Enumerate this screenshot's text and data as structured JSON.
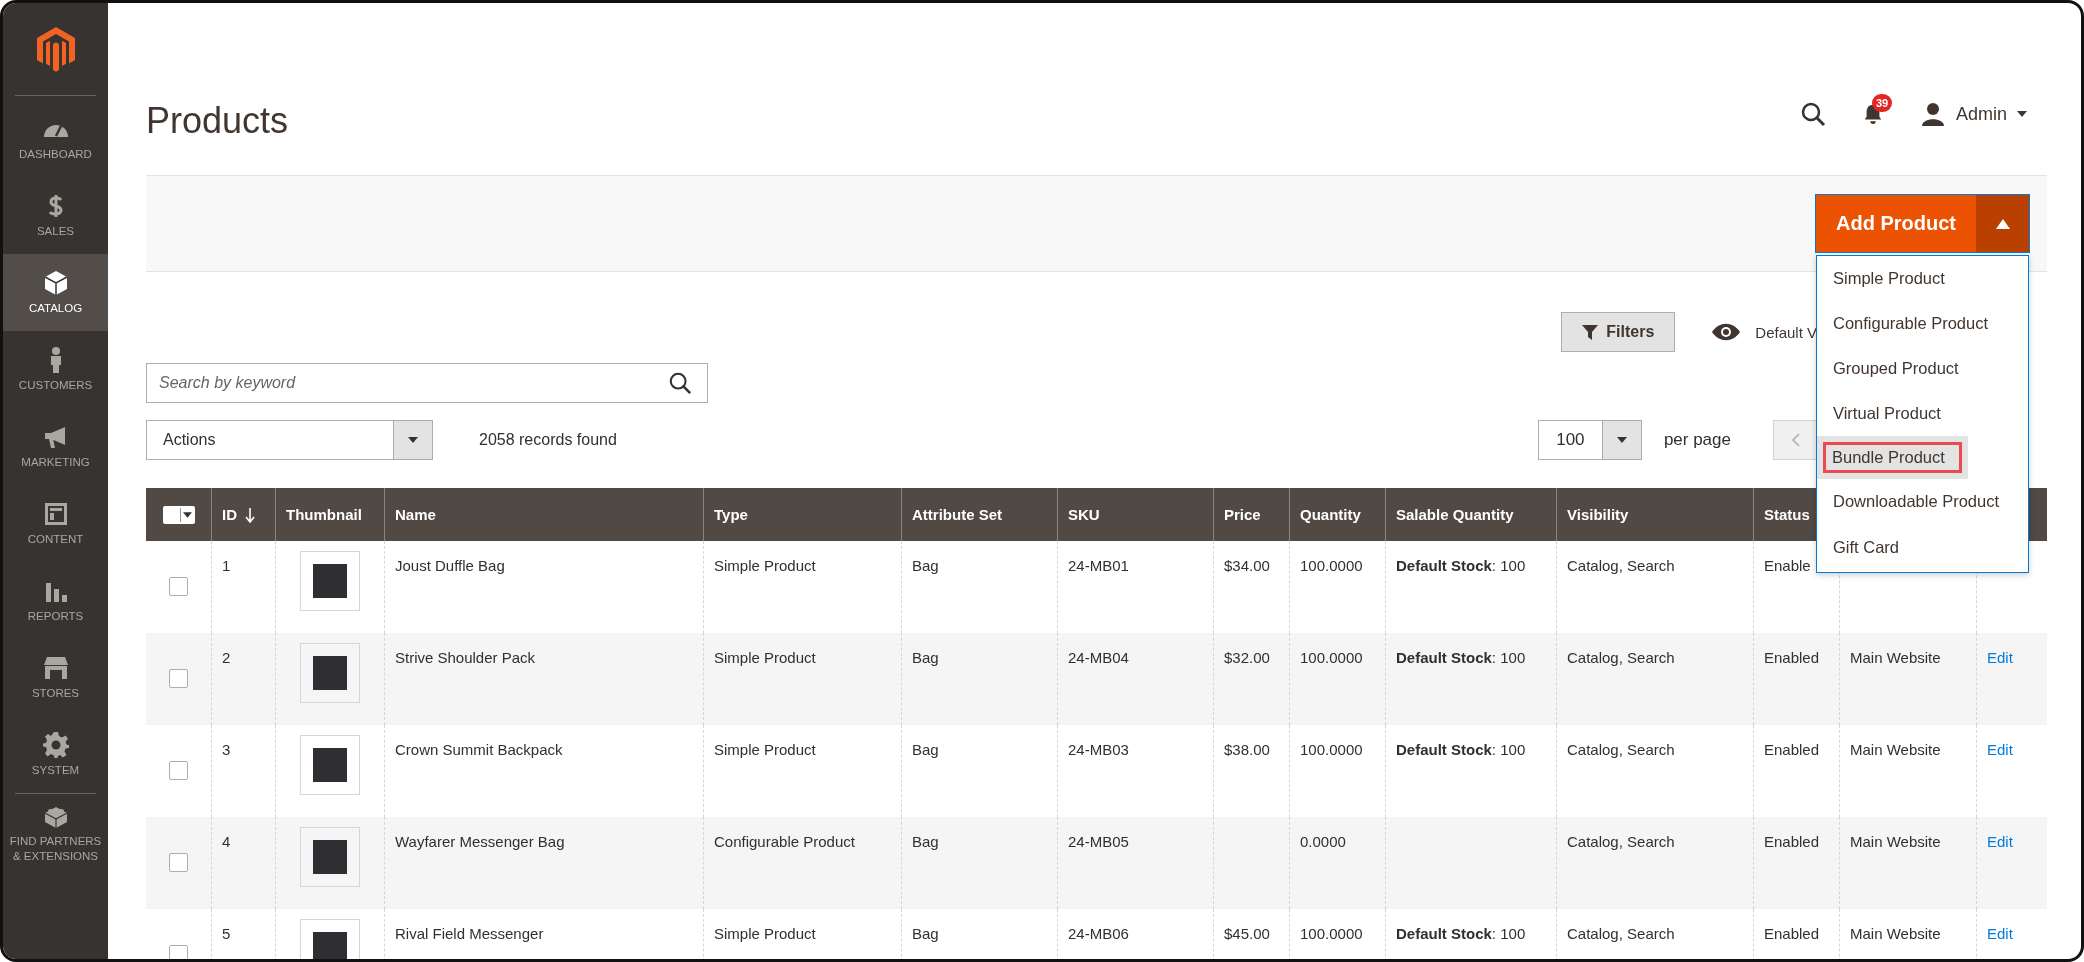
{
  "sidebar": {
    "items": [
      {
        "label": "DASHBOARD",
        "selected": false
      },
      {
        "label": "SALES",
        "selected": false
      },
      {
        "label": "CATALOG",
        "selected": true
      },
      {
        "label": "CUSTOMERS",
        "selected": false
      },
      {
        "label": "MARKETING",
        "selected": false
      },
      {
        "label": "CONTENT",
        "selected": false
      },
      {
        "label": "REPORTS",
        "selected": false
      },
      {
        "label": "STORES",
        "selected": false
      },
      {
        "label": "SYSTEM",
        "selected": false
      },
      {
        "label": "FIND PARTNERS & EXTENSIONS",
        "selected": false
      }
    ]
  },
  "header": {
    "title": "Products",
    "notification_count": "39",
    "user": "Admin"
  },
  "add_product": {
    "label": "Add Product",
    "expanded": true,
    "menu": [
      {
        "label": "Simple Product",
        "selected": false
      },
      {
        "label": "Configurable Product",
        "selected": false
      },
      {
        "label": "Grouped Product",
        "selected": false
      },
      {
        "label": "Virtual Product",
        "selected": false
      },
      {
        "label": "Bundle Product",
        "selected": true
      },
      {
        "label": "Downloadable Product",
        "selected": false
      },
      {
        "label": "Gift Card",
        "selected": false
      }
    ]
  },
  "toolbar": {
    "filters": "Filters",
    "view": "Default V",
    "search_placeholder": "Search by keyword",
    "actions": "Actions",
    "records": "2058 records found",
    "per_page": "100",
    "per_page_label": "per page"
  },
  "table": {
    "columns": [
      {
        "label": "ID",
        "sorted": true
      },
      {
        "label": "Thumbnail",
        "sorted": false
      },
      {
        "label": "Name",
        "sorted": false
      },
      {
        "label": "Type",
        "sorted": false
      },
      {
        "label": "Attribute Set",
        "sorted": false
      },
      {
        "label": "SKU",
        "sorted": false
      },
      {
        "label": "Price",
        "sorted": false
      },
      {
        "label": "Quantity",
        "sorted": false
      },
      {
        "label": "Salable Quantity",
        "sorted": false
      },
      {
        "label": "Visibility",
        "sorted": false
      },
      {
        "label": "Status",
        "sorted": false
      }
    ],
    "rows": [
      {
        "checked": false,
        "id": "1",
        "name": "Joust Duffle Bag",
        "type": "Simple Product",
        "attribute_set": "Bag",
        "sku": "24-MB01",
        "price": "$34.00",
        "quantity": "100.0000",
        "salable": "**Default Stock**: 100",
        "visibility": "Catalog, Search",
        "status": "Enable"
      },
      {
        "checked": false,
        "id": "2",
        "name": "Strive Shoulder Pack",
        "type": "Simple Product",
        "attribute_set": "Bag",
        "sku": "24-MB04",
        "price": "$32.00",
        "quantity": "100.0000",
        "salable": "**Default Stock**: 100",
        "visibility": "Catalog, Search",
        "status": "Enabled",
        "website": "Main Website",
        "action": "Edit"
      },
      {
        "checked": false,
        "id": "3",
        "name": "Crown Summit Backpack",
        "type": "Simple Product",
        "attribute_set": "Bag",
        "sku": "24-MB03",
        "price": "$38.00",
        "quantity": "100.0000",
        "salable": "**Default Stock**: 100",
        "visibility": "Catalog, Search",
        "status": "Enabled",
        "website": "Main Website",
        "action": "Edit"
      },
      {
        "checked": false,
        "id": "4",
        "name": "Wayfarer Messenger Bag",
        "type": "Configurable Product",
        "attribute_set": "Bag",
        "sku": "24-MB05",
        "quantity": "0.0000",
        "visibility": "Catalog, Search",
        "status": "Enabled",
        "website": "Main Website",
        "action": "Edit"
      },
      {
        "checked": false,
        "id": "5",
        "name": "Rival Field Messenger",
        "type": "Simple Product",
        "attribute_set": "Bag",
        "sku": "24-MB06",
        "price": "$45.00",
        "quantity": "100.0000",
        "salable": "**Default Stock**: 100",
        "visibility": "Catalog, Search",
        "status": "Enabled",
        "website": "Main Website",
        "action": "Edit"
      }
    ]
  }
}
